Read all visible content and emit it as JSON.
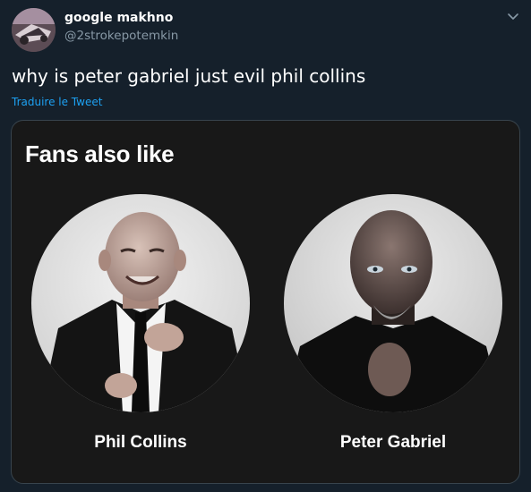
{
  "tweet": {
    "display_name": "google makhno",
    "handle": "@2strokepotemkin",
    "text": "why is peter gabriel just evil phil collins",
    "translate_label": "Traduire le Tweet"
  },
  "card": {
    "title": "Fans also like",
    "artists": [
      {
        "name": "Phil Collins"
      },
      {
        "name": "Peter Gabriel"
      }
    ]
  },
  "icons": {
    "menu": "chevron-down-icon"
  },
  "colors": {
    "background": "#15202b",
    "text": "#ffffff",
    "secondary_text": "#8899a6",
    "link": "#1da1f2",
    "card_background": "#181818",
    "card_border": "#38444d"
  }
}
